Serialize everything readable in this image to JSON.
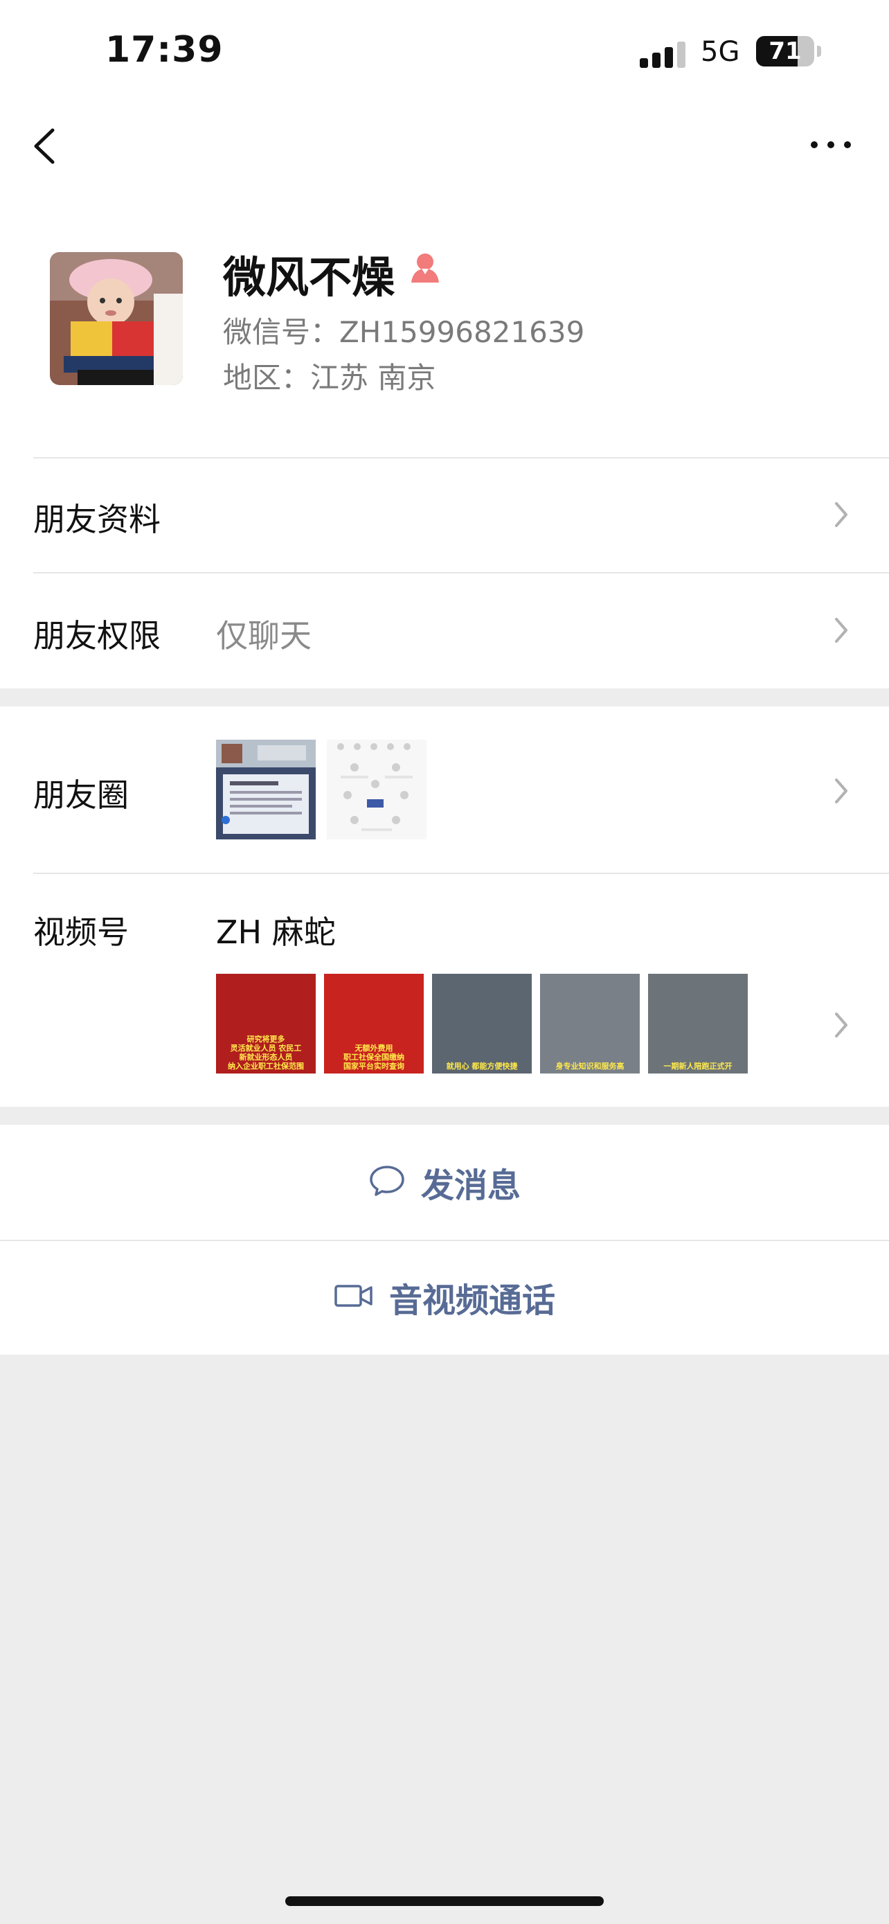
{
  "status_bar": {
    "time": "17:39",
    "network": "5G",
    "battery": "71",
    "battery_level": 0.71
  },
  "profile": {
    "name": "微风不燥",
    "gender_icon": "female-icon",
    "wechat_id": "微信号：ZH15996821639",
    "region": "地区：江苏 南京"
  },
  "rows": {
    "friend_info": "朋友资料",
    "friend_permission": "朋友权限",
    "friend_permission_value": "仅聊天",
    "moments": "朋友圈",
    "channels": "视频号",
    "channels_name": "ZH 麻蛇"
  },
  "channel_thumbs": [
    {
      "title": "研究将更多\n灵活就业人员 农民工\n新就业形态人员\n纳入企业职工社保范围",
      "color": "#b01e1e"
    },
    {
      "title": "无额外费用\n职工社保全国缴纳\n国家平台实时查询",
      "color": "#c8231f"
    },
    {
      "title": "就用心 都能方便快捷",
      "color": "#5c6670"
    },
    {
      "title": "身专业知识和服务高",
      "color": "#7a8088"
    },
    {
      "title": "一期新人陪跑正式开",
      "color": "#6d7479"
    }
  ],
  "actions": {
    "message": "发消息",
    "call": "音视频通话"
  },
  "colors": {
    "link": "#576b95",
    "background": "#ededed",
    "gender_female": "#f27b7b"
  }
}
